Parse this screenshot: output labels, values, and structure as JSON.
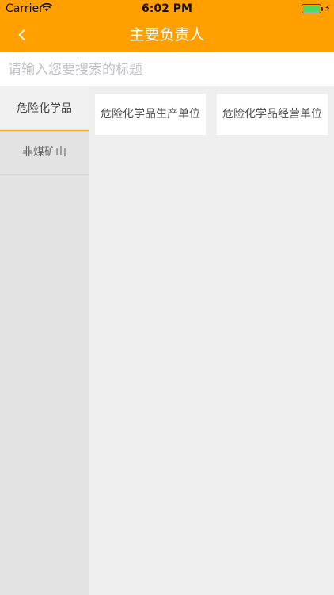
{
  "status_bar": {
    "carrier": "Carrier",
    "time": "6:02 PM",
    "icons": [
      "wifi-icon",
      "battery-icon",
      "charging-icon"
    ]
  },
  "navbar": {
    "title": "主要负责人",
    "back_icon": "chevron-left-icon",
    "background_color": "#ff9f00"
  },
  "search": {
    "value": "",
    "placeholder": "请输入您要搜索的标题"
  },
  "sidebar": {
    "items": [
      {
        "label": "危险化学品",
        "active": true
      },
      {
        "label": "非煤矿山",
        "active": false
      }
    ]
  },
  "content": {
    "cards": [
      {
        "label": "危险化学品生产单位"
      },
      {
        "label": "危险化学品经营单位"
      }
    ]
  }
}
